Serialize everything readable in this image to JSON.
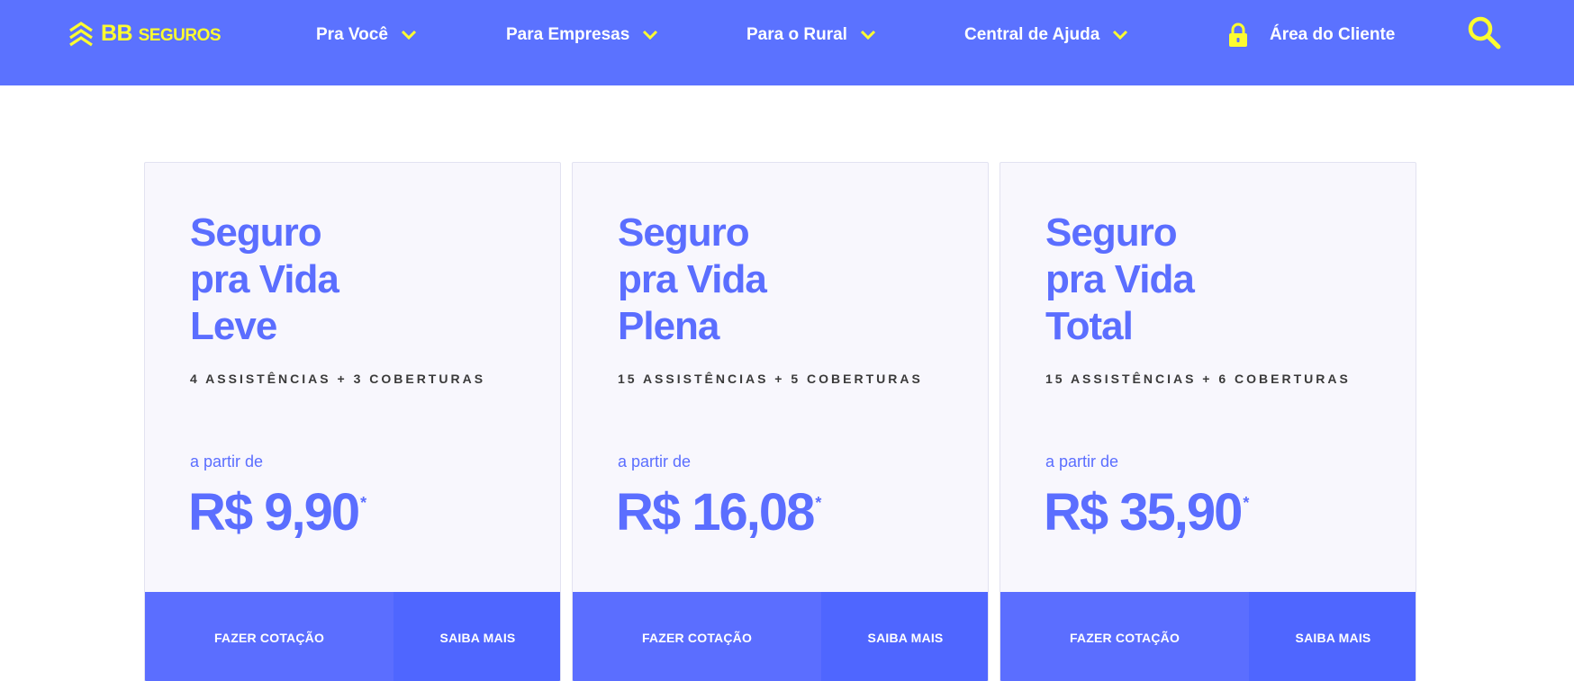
{
  "brand": {
    "logo_main": "BB",
    "logo_rest": "SEGUROS"
  },
  "colors": {
    "header_bg": "#5b72ff",
    "accent_yellow": "#fcfc30",
    "card_bg": "#f8f7fd",
    "primary_blue": "#5b6eff"
  },
  "nav": [
    {
      "label": "Pra Você",
      "icon": "chevron-down-icon"
    },
    {
      "label": "Para Empresas",
      "icon": "chevron-down-icon"
    },
    {
      "label": "Para o Rural",
      "icon": "chevron-down-icon"
    },
    {
      "label": "Central de Ajuda",
      "icon": "chevron-down-icon"
    }
  ],
  "client_area": {
    "label": "Área do Cliente",
    "icon": "lock-icon"
  },
  "search": {
    "icon": "search-icon"
  },
  "cards": [
    {
      "title_line1": "Seguro",
      "title_line2": "pra Vida",
      "title_line3": "Leve",
      "subtitle": "4 ASSISTÊNCIAS + 3 COBERTURAS",
      "from_label": "a partir de",
      "price": "R$ 9,90",
      "asterisk": "*",
      "quote_button": "FAZER COTAÇÃO",
      "more_button": "SAIBA MAIS"
    },
    {
      "title_line1": "Seguro",
      "title_line2": "pra Vida",
      "title_line3": "Plena",
      "subtitle": "15 ASSISTÊNCIAS + 5 COBERTURAS",
      "from_label": "a partir de",
      "price": "R$ 16,08",
      "asterisk": "*",
      "quote_button": "FAZER COTAÇÃO",
      "more_button": "SAIBA MAIS"
    },
    {
      "title_line1": "Seguro",
      "title_line2": "pra Vida",
      "title_line3": "Total",
      "subtitle": "15 ASSISTÊNCIAS + 6 COBERTURAS",
      "from_label": "a partir de",
      "price": "R$ 35,90",
      "asterisk": "*",
      "quote_button": "FAZER COTAÇÃO",
      "more_button": "SAIBA MAIS"
    }
  ]
}
